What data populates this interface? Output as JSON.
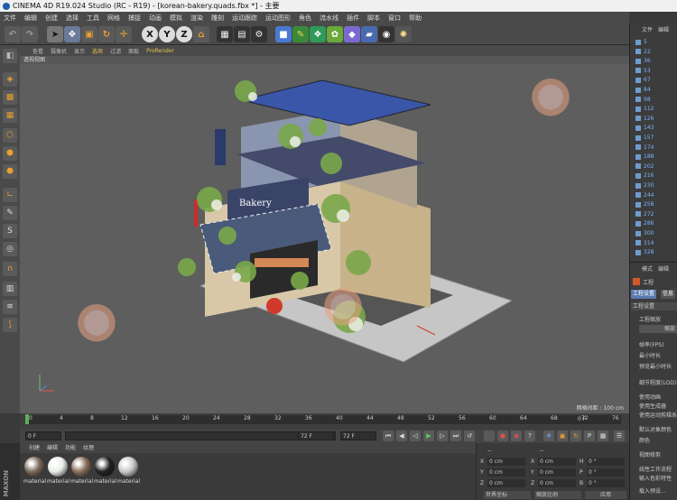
{
  "window": {
    "title": "CINEMA 4D R19.024 Studio (RC - R19) - [korean-bakery.quads.fbx *] - 主要"
  },
  "menubar": [
    "文件",
    "编辑",
    "创建",
    "选择",
    "工具",
    "网格",
    "捕捉",
    "动画",
    "模拟",
    "渲染",
    "雕刻",
    "运动跟踪",
    "运动图形",
    "角色",
    "流水线",
    "插件",
    "脚本",
    "窗口",
    "帮助"
  ],
  "toolbar": {
    "axis_x": "X",
    "axis_y": "Y",
    "axis_z": "Z"
  },
  "viewport": {
    "menu": [
      "查看",
      "摄像机",
      "显示",
      "选项",
      "过滤",
      "面板",
      "ProRender"
    ],
    "label": "透视视图",
    "grid_info": "网格间距 : 100 cm",
    "sign_text": "Bakery"
  },
  "timeline": {
    "ticks": [
      "0",
      "4",
      "8",
      "12",
      "16",
      "20",
      "24",
      "28",
      "32",
      "36",
      "40",
      "44",
      "48",
      "52",
      "56",
      "60",
      "64",
      "68",
      "72",
      "76"
    ],
    "end_marker": "0 F",
    "start_field": "0 F",
    "cur_field": "0 F",
    "end_field": "72 F",
    "end_field2": "72 F"
  },
  "material_manager": {
    "menu": [
      "创建",
      "编辑",
      "功能",
      "纹理"
    ],
    "materials": [
      {
        "label": "material",
        "color": "#7a6a5a"
      },
      {
        "label": "material",
        "color": "#e8ede8"
      },
      {
        "label": "material",
        "color": "#8a6e5a"
      },
      {
        "label": "material",
        "color": "#222222"
      },
      {
        "label": "material",
        "color": "#c8c8c8"
      }
    ]
  },
  "coordinates": {
    "header": [
      "--",
      "--"
    ],
    "rows": [
      {
        "axis": "X",
        "pos": "0 cm",
        "axis2": "X",
        "size": "0 cm",
        "r": "H",
        "rot": "0 °"
      },
      {
        "axis": "Y",
        "pos": "0 cm",
        "axis2": "Y",
        "size": "0 cm",
        "r": "P",
        "rot": "0 °"
      },
      {
        "axis": "Z",
        "pos": "0 cm",
        "axis2": "Z",
        "size": "0 cm",
        "r": "B",
        "rot": "0 °"
      }
    ],
    "mode1": "世界坐标",
    "mode2": "缩放比例",
    "apply": "应用"
  },
  "object_manager": {
    "tabs": [
      "文件",
      "编辑"
    ],
    "items": [
      "5",
      "22",
      "36",
      "53",
      "67",
      "84",
      "98",
      "112",
      "126",
      "143",
      "157",
      "174",
      "188",
      "202",
      "216",
      "230",
      "244",
      "258",
      "272",
      "286",
      "300",
      "314",
      "328"
    ]
  },
  "attributes": {
    "tabs": [
      "模式",
      "编辑"
    ],
    "title": "工程",
    "subtab1": "工程设置",
    "subtab2": "信息",
    "section": "工程设置",
    "rows": [
      "工程缩放",
      "帧率(FPS)",
      "最小时长",
      "预览最小时长",
      "细节程度(LOD)",
      "使用动画",
      "使用生成器",
      "使用运动剪辑系统",
      "默认对象颜色",
      "颜色",
      "视图修剪",
      "线性工作流程",
      "输入色彩特性",
      "载入预设..."
    ],
    "scale_button": "缩放"
  }
}
